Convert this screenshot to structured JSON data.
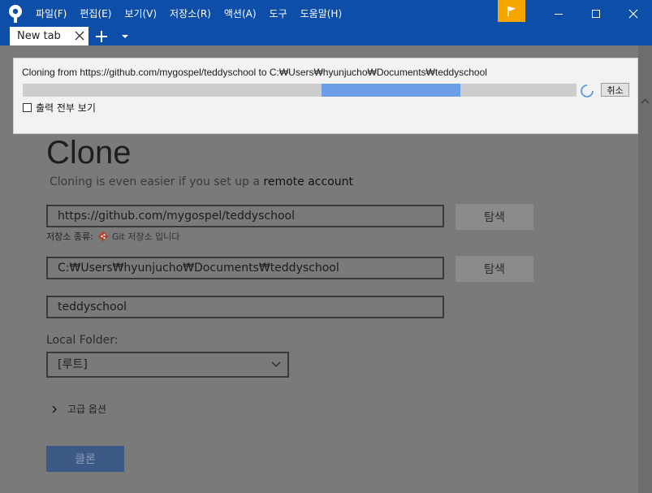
{
  "menu": [
    "파일(F)",
    "편집(E)",
    "보기(V)",
    "저장소(R)",
    "액션(A)",
    "도구",
    "도움말(H)"
  ],
  "colors": {
    "titlebar": "#0c4ea8",
    "flag": "#f5a700",
    "progress": "#6b9de8",
    "clone_button": "#3d5a86"
  },
  "tab": {
    "label": "New tab"
  },
  "dialog": {
    "message": "Cloning from https://github.com/mygospel/teddyschool to C:₩Users₩hyunjucho₩Documents₩teddyschool",
    "progress_start": 0.54,
    "progress_end": 0.79,
    "cancel_label": "취소",
    "show_output_label": "출력 전부 보기"
  },
  "clone": {
    "title": "Clone",
    "subtitle_text": "Cloning is even easier if you set up a ",
    "subtitle_link": "remote account",
    "source_url": "https://github.com/mygospel/teddyschool",
    "browse_label": "탐색",
    "repo_type_label": "저장소 종류:",
    "repo_type_value": "Git 저장소 입니다",
    "destination_path": "C:₩Users₩hyunjucho₩Documents₩teddyschool",
    "name": "teddyschool",
    "local_folder_label": "Local Folder:",
    "local_folder_value": "[루트]",
    "advanced_label": "고급 옵션",
    "clone_button": "클론"
  }
}
